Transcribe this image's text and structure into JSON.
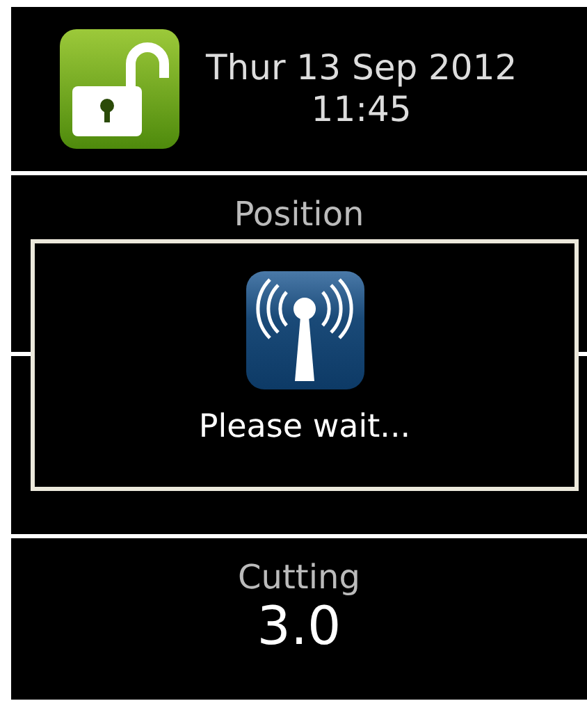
{
  "header": {
    "date": "Thur 13 Sep 2012",
    "time": "11:45",
    "locked": false
  },
  "panels": [
    {
      "label": "Position"
    },
    {
      "label": "Cutting",
      "value": "3.0"
    }
  ],
  "dialog": {
    "message": "Please wait..."
  }
}
